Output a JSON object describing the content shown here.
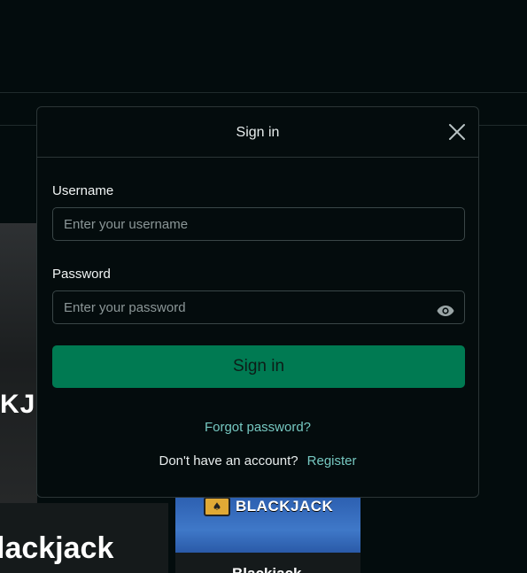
{
  "modal": {
    "title": "Sign in",
    "close_icon": "close-icon",
    "username": {
      "label": "Username",
      "value": "",
      "placeholder": "Enter your username"
    },
    "password": {
      "label": "Password",
      "value": "",
      "placeholder": "Enter your password",
      "toggle_icon": "eye-icon"
    },
    "submit_label": "Sign in",
    "forgot_label": "Forgot password?",
    "register_prompt": "Don't have an account?",
    "register_label": "Register"
  },
  "background": {
    "left_card_partial_text": "KJ",
    "left_card_title": "lackjack",
    "right_card_logo_label": "BLACKJACK",
    "right_card_title": "Blackjack"
  },
  "colors": {
    "page_bg": "#030c0d",
    "primary_button": "#007a52",
    "link": "#76c8c1",
    "border": "#2b3536"
  }
}
